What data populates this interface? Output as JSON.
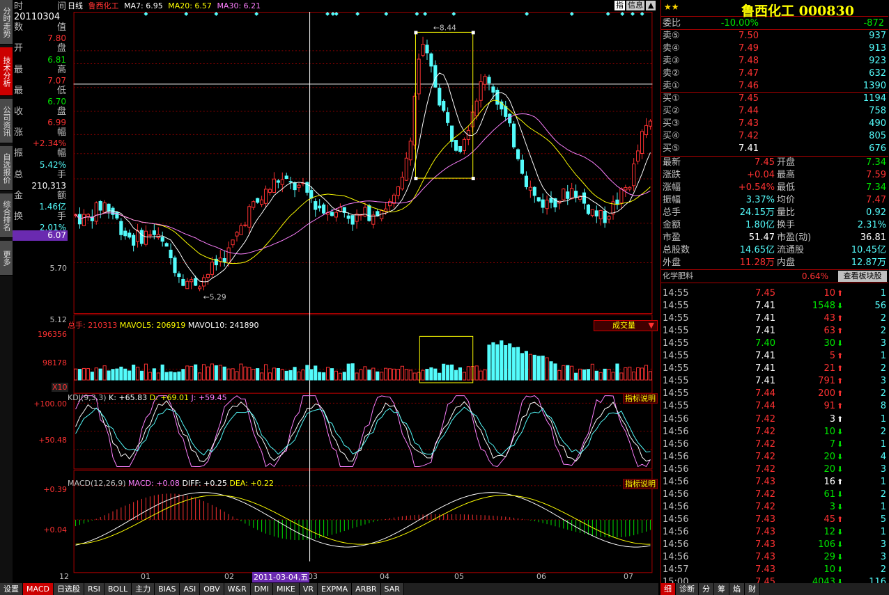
{
  "left_tabs": [
    "分时走势",
    "技术分析",
    "公司资讯",
    "自选报价",
    "综合排名",
    "更多"
  ],
  "info": {
    "rows": [
      {
        "l": "时",
        "r": "间"
      },
      {
        "l": "20110304",
        "r": ""
      },
      {
        "l": "数",
        "r": "值"
      },
      {
        "l": "",
        "r": "7.80",
        "c": "red"
      },
      {
        "l": "开",
        "r": "盘"
      },
      {
        "l": "",
        "r": "6.81",
        "c": "green"
      },
      {
        "l": "最",
        "r": "高"
      },
      {
        "l": "",
        "r": "7.07",
        "c": "red"
      },
      {
        "l": "最",
        "r": "低"
      },
      {
        "l": "",
        "r": "6.70",
        "c": "green"
      },
      {
        "l": "收",
        "r": "盘"
      },
      {
        "l": "",
        "r": "6.99",
        "c": "red"
      },
      {
        "l": "涨",
        "r": "幅"
      },
      {
        "l": "",
        "r": "+2.34%",
        "c": "red"
      },
      {
        "l": "振",
        "r": "幅"
      },
      {
        "l": "",
        "r": "5.42%",
        "c": "cyan"
      },
      {
        "l": "总",
        "r": "手"
      },
      {
        "l": "",
        "r": "210,313",
        "c": "white"
      },
      {
        "l": "金",
        "r": "额"
      },
      {
        "l": "",
        "r": "1.46亿",
        "c": "cyan"
      },
      {
        "l": "换",
        "r": "手"
      },
      {
        "l": "",
        "r": "2.01%",
        "c": "cyan"
      }
    ],
    "cursor_price": "6.07"
  },
  "header": {
    "period": "日线",
    "name": "鲁西化工",
    "ma7": "MA7: 6.95",
    "ma20": "MA20: 6.57",
    "ma30": "MA30: 6.21",
    "btn_zhi": "指",
    "btn_info": "信息"
  },
  "price_axis": [
    "5.70",
    "5.12"
  ],
  "annot": {
    "high": "8.44",
    "low": "5.29"
  },
  "vol": {
    "hdr_total": "总手: 210313",
    "hdr_ma5": "MAVOL5: 206919",
    "hdr_ma10": "MAVOL10: 241890",
    "dropdown": "成交量",
    "ax_top": "196356",
    "ax_mid": "98178",
    "ax_x10": "X10"
  },
  "kdj": {
    "hdr": "KDJ(9,3,3)",
    "k": "K: +65.83",
    "d": "D: +69.01",
    "j": "J: +59.45",
    "explain": "指标说明",
    "ax_top": "+100.00",
    "ax_mid": "+50.48"
  },
  "macd": {
    "hdr": "MACD(12,26,9)",
    "macd": "MACD: +0.08",
    "diff": "DIFF: +0.25",
    "dea": "DEA: +0.22",
    "explain": "指标说明",
    "ax_top": "+0.39",
    "ax_mid": "+0.04"
  },
  "xaxis": [
    "12",
    "01",
    "02",
    "03",
    "04",
    "05",
    "06",
    "07"
  ],
  "cursor_date": "2011-03-04,五",
  "bottom_tabs": [
    "设置",
    "MACD",
    "日选股",
    "RSI",
    "BOLL",
    "主力",
    "BIAS",
    "ASI",
    "OBV",
    "W&R",
    "DMI",
    "MIKE",
    "VR",
    "EXPMA",
    "ARBR",
    "SAR"
  ],
  "right": {
    "title": "鲁西化工 000830",
    "weibi": {
      "l": "委比",
      "v1": "-10.00%",
      "v2": "-872"
    },
    "sells": [
      {
        "l": "卖⑤",
        "p": "7.50",
        "v": "937"
      },
      {
        "l": "卖④",
        "p": "7.49",
        "v": "913"
      },
      {
        "l": "卖③",
        "p": "7.48",
        "v": "923"
      },
      {
        "l": "卖②",
        "p": "7.47",
        "v": "632"
      },
      {
        "l": "卖①",
        "p": "7.46",
        "v": "1390"
      }
    ],
    "buys": [
      {
        "l": "买①",
        "p": "7.45",
        "v": "1194"
      },
      {
        "l": "买②",
        "p": "7.44",
        "v": "758"
      },
      {
        "l": "买③",
        "p": "7.43",
        "v": "490"
      },
      {
        "l": "买④",
        "p": "7.42",
        "v": "805"
      },
      {
        "l": "买⑤",
        "p": "7.41",
        "v": "676"
      }
    ],
    "stats": [
      {
        "l1": "最新",
        "v1": "7.45",
        "c1": "red",
        "l2": "开盘",
        "v2": "7.34",
        "c2": "green"
      },
      {
        "l1": "涨跌",
        "v1": "+0.04",
        "c1": "red",
        "l2": "最高",
        "v2": "7.59",
        "c2": "red"
      },
      {
        "l1": "涨幅",
        "v1": "+0.54%",
        "c1": "red",
        "l2": "最低",
        "v2": "7.34",
        "c2": "green"
      },
      {
        "l1": "振幅",
        "v1": "3.37%",
        "c1": "cyan",
        "l2": "均价",
        "v2": "7.47",
        "c2": "red"
      },
      {
        "l1": "总手",
        "v1": "24.15万",
        "c1": "cyan",
        "l2": "量比",
        "v2": "0.92",
        "c2": "cyan"
      },
      {
        "l1": "金额",
        "v1": "1.80亿",
        "c1": "cyan",
        "l2": "换手",
        "v2": "2.31%",
        "c2": "cyan"
      },
      {
        "l1": "市盈",
        "v1": "51.47",
        "c1": "white",
        "l2": "市盈(动)",
        "v2": "36.81",
        "c2": "white"
      },
      {
        "l1": "总股数",
        "v1": "14.65亿",
        "c1": "cyan",
        "l2": "流通股",
        "v2": "10.45亿",
        "c2": "cyan"
      },
      {
        "l1": "外盘",
        "v1": "11.28万",
        "c1": "red",
        "l2": "内盘",
        "v2": "12.87万",
        "c2": "cyan"
      }
    ],
    "sector": {
      "name": "化学肥料",
      "pct": "0.64%",
      "btn": "查看板块股"
    },
    "ticks": [
      {
        "t": "14:55",
        "p": "7.45",
        "pc": "red",
        "v": "10",
        "d": "up",
        "n": "1"
      },
      {
        "t": "14:55",
        "p": "7.41",
        "pc": "white",
        "v": "1548",
        "d": "down",
        "n": "56"
      },
      {
        "t": "14:55",
        "p": "7.41",
        "pc": "white",
        "v": "43",
        "d": "up",
        "n": "2"
      },
      {
        "t": "14:55",
        "p": "7.41",
        "pc": "white",
        "v": "63",
        "d": "up",
        "n": "2"
      },
      {
        "t": "14:55",
        "p": "7.40",
        "pc": "green",
        "v": "30",
        "d": "down",
        "n": "3"
      },
      {
        "t": "14:55",
        "p": "7.41",
        "pc": "white",
        "v": "5",
        "d": "up",
        "n": "1"
      },
      {
        "t": "14:55",
        "p": "7.41",
        "pc": "white",
        "v": "21",
        "d": "up",
        "n": "2"
      },
      {
        "t": "14:55",
        "p": "7.41",
        "pc": "white",
        "v": "791",
        "d": "up",
        "n": "3"
      },
      {
        "t": "14:55",
        "p": "7.44",
        "pc": "red",
        "v": "200",
        "d": "up",
        "n": "2"
      },
      {
        "t": "14:55",
        "p": "7.44",
        "pc": "red",
        "v": "91",
        "d": "up",
        "n": "8"
      },
      {
        "t": "14:56",
        "p": "7.42",
        "pc": "red",
        "v": "3",
        "d": "flat",
        "n": "1"
      },
      {
        "t": "14:56",
        "p": "7.42",
        "pc": "red",
        "v": "10",
        "d": "down",
        "n": "2"
      },
      {
        "t": "14:56",
        "p": "7.42",
        "pc": "red",
        "v": "7",
        "d": "down",
        "n": "1"
      },
      {
        "t": "14:56",
        "p": "7.42",
        "pc": "red",
        "v": "20",
        "d": "down",
        "n": "4"
      },
      {
        "t": "14:56",
        "p": "7.42",
        "pc": "red",
        "v": "20",
        "d": "down",
        "n": "3"
      },
      {
        "t": "14:56",
        "p": "7.43",
        "pc": "red",
        "v": "16",
        "d": "flat",
        "n": "1"
      },
      {
        "t": "14:56",
        "p": "7.42",
        "pc": "red",
        "v": "61",
        "d": "down",
        "n": "2"
      },
      {
        "t": "14:56",
        "p": "7.42",
        "pc": "red",
        "v": "3",
        "d": "down",
        "n": "1"
      },
      {
        "t": "14:56",
        "p": "7.43",
        "pc": "red",
        "v": "45",
        "d": "up",
        "n": "5"
      },
      {
        "t": "14:56",
        "p": "7.43",
        "pc": "red",
        "v": "12",
        "d": "down",
        "n": "1"
      },
      {
        "t": "14:56",
        "p": "7.43",
        "pc": "red",
        "v": "106",
        "d": "down",
        "n": "3"
      },
      {
        "t": "14:56",
        "p": "7.43",
        "pc": "red",
        "v": "29",
        "d": "down",
        "n": "3"
      },
      {
        "t": "14:57",
        "p": "7.43",
        "pc": "red",
        "v": "10",
        "d": "down",
        "n": "2"
      },
      {
        "t": "15:00",
        "p": "7.45",
        "pc": "red",
        "v": "4043",
        "d": "down",
        "n": "116"
      }
    ],
    "bottom_tabs": [
      "细",
      "诊断",
      "分",
      "筹",
      "焰",
      "财"
    ]
  },
  "colors": {
    "red": "#ff3232",
    "green": "#00e600",
    "cyan": "#54fcfc",
    "white": "#ffffff",
    "yellow": "#ffff00",
    "magenta": "#ff80ff",
    "grid": "#800000"
  }
}
